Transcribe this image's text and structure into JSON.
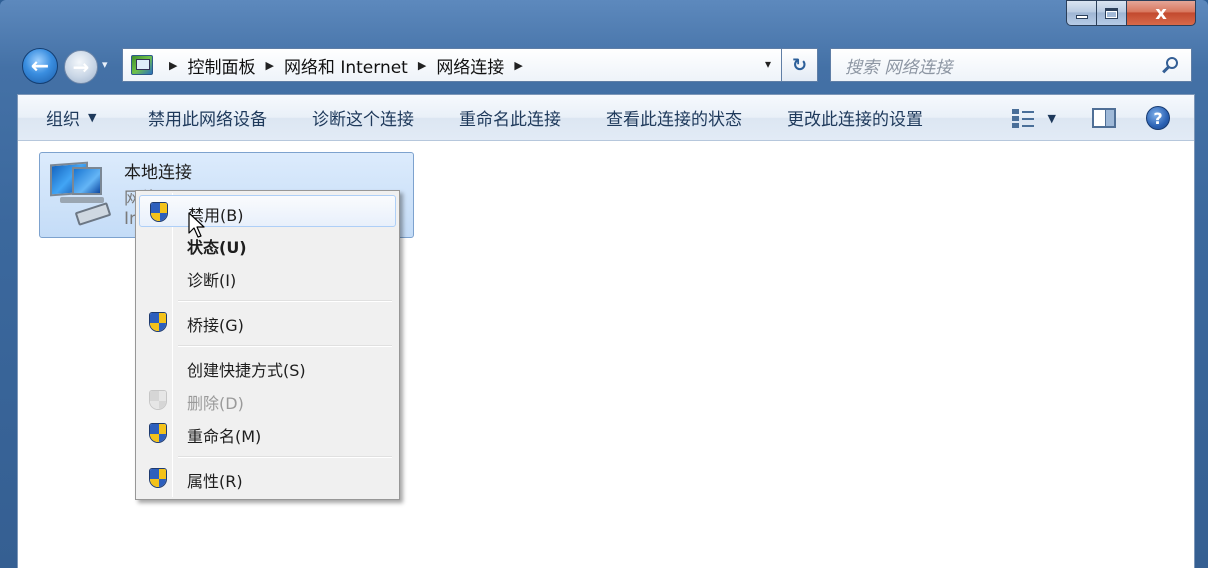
{
  "window": {
    "close_glyph": "x"
  },
  "nav": {
    "back_glyph": "←",
    "forward_glyph": "→",
    "history_glyph": "▾",
    "breadcrumbs": [
      "控制面板",
      "网络和 Internet",
      "网络连接"
    ],
    "separator_glyph": "▶",
    "dropdown_glyph": "▾",
    "refresh_glyph": "↻"
  },
  "search": {
    "placeholder": "搜索 网络连接"
  },
  "toolbar": {
    "organize": "组织",
    "caret": "▼",
    "items": [
      "禁用此网络设备",
      "诊断这个连接",
      "重命名此连接",
      "查看此连接的状态",
      "更改此连接的设置"
    ],
    "help_glyph": "?"
  },
  "connection": {
    "name": "本地连接",
    "line2": "网络",
    "line3": "In"
  },
  "context_menu": {
    "items": [
      {
        "label": "禁用(B)",
        "shield": true,
        "state": "hover"
      },
      {
        "label": "状态(U)",
        "shield": false,
        "state": "default-bold"
      },
      {
        "label": "诊断(I)",
        "shield": false,
        "state": "normal"
      },
      {
        "label": "桥接(G)",
        "shield": true,
        "state": "normal"
      },
      {
        "label": "创建快捷方式(S)",
        "shield": false,
        "state": "normal"
      },
      {
        "label": "删除(D)",
        "shield": true,
        "state": "disabled"
      },
      {
        "label": "重命名(M)",
        "shield": true,
        "state": "normal"
      },
      {
        "label": "属性(R)",
        "shield": true,
        "state": "normal"
      }
    ]
  },
  "colors": {
    "frame_blue": "#3b689d",
    "selection_bg": "#c4dcf7",
    "menu_bg": "#f0f0f0",
    "shield_blue": "#2d5fbd",
    "shield_yellow": "#f3c21a"
  }
}
